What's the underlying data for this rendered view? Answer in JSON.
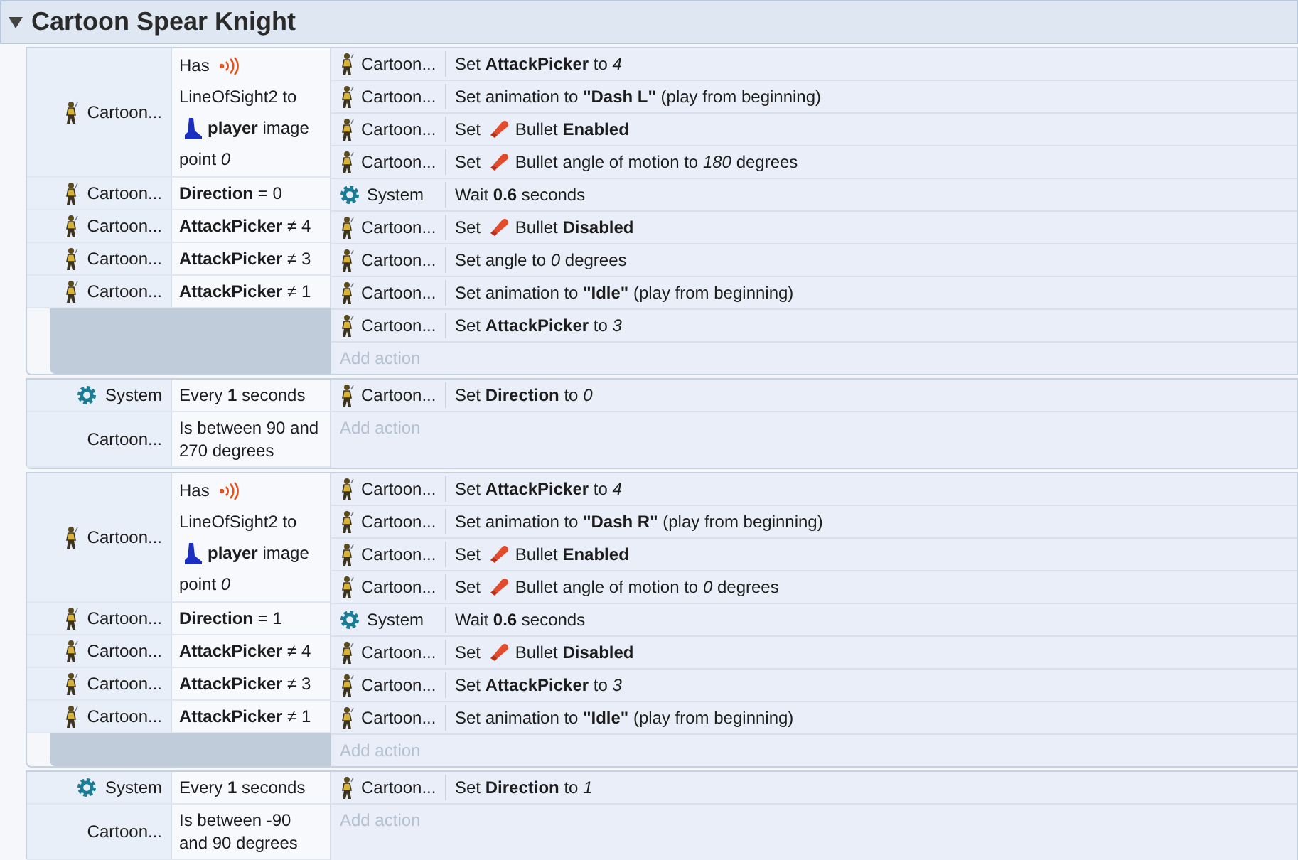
{
  "section": {
    "title": "Cartoon Spear Knight"
  },
  "events": [
    {
      "conditions": [
        {
          "kind": "sprite",
          "object": "Cartoon...",
          "parts": [
            {
              "kind": "text",
              "text": "Has"
            },
            {
              "kind": "signal"
            },
            {
              "kind": "text",
              "text": "LineOfSight2 to"
            },
            {
              "kind": "figure"
            },
            {
              "kind": "text",
              "text": "**player** image"
            },
            {
              "kind": "text",
              "text": "point *0*"
            }
          ]
        },
        {
          "kind": "sprite",
          "object": "Cartoon...",
          "parts": [
            {
              "kind": "text",
              "text": "**Direction** = 0"
            }
          ]
        },
        {
          "kind": "sprite",
          "object": "Cartoon...",
          "parts": [
            {
              "kind": "text",
              "text": "**AttackPicker** ≠ 4"
            }
          ]
        },
        {
          "kind": "sprite",
          "object": "Cartoon...",
          "parts": [
            {
              "kind": "text",
              "text": "**AttackPicker** ≠ 3"
            }
          ]
        },
        {
          "kind": "sprite",
          "object": "Cartoon...",
          "parts": [
            {
              "kind": "text",
              "text": "**AttackPicker** ≠ 1"
            }
          ]
        }
      ],
      "actions": [
        {
          "kind": "sprite",
          "object": "Cartoon...",
          "parts": [
            {
              "kind": "text",
              "text": "Set **AttackPicker** to *4*"
            }
          ]
        },
        {
          "kind": "sprite",
          "object": "Cartoon...",
          "parts": [
            {
              "kind": "text",
              "text": "Set animation to **\"Dash L\"** (play from beginning)"
            }
          ]
        },
        {
          "kind": "sprite",
          "object": "Cartoon...",
          "parts": [
            {
              "kind": "text",
              "text": "Set"
            },
            {
              "kind": "bullet"
            },
            {
              "kind": "text",
              "text": "Bullet **Enabled**"
            }
          ]
        },
        {
          "kind": "sprite",
          "object": "Cartoon...",
          "parts": [
            {
              "kind": "text",
              "text": "Set"
            },
            {
              "kind": "bullet"
            },
            {
              "kind": "text",
              "text": "Bullet angle of motion to *180* degrees"
            }
          ]
        },
        {
          "kind": "system",
          "object": "System",
          "parts": [
            {
              "kind": "text",
              "text": "Wait **0.6** seconds"
            }
          ]
        },
        {
          "kind": "sprite",
          "object": "Cartoon...",
          "parts": [
            {
              "kind": "text",
              "text": "Set"
            },
            {
              "kind": "bullet"
            },
            {
              "kind": "text",
              "text": "Bullet **Disabled**"
            }
          ]
        },
        {
          "kind": "sprite",
          "object": "Cartoon...",
          "parts": [
            {
              "kind": "text",
              "text": "Set angle to *0* degrees"
            }
          ]
        },
        {
          "kind": "sprite",
          "object": "Cartoon...",
          "parts": [
            {
              "kind": "text",
              "text": "Set animation to **\"Idle\"** (play from beginning)"
            }
          ]
        },
        {
          "kind": "sprite",
          "object": "Cartoon...",
          "parts": [
            {
              "kind": "text",
              "text": "Set **AttackPicker** to *3*"
            }
          ]
        }
      ],
      "add_action": "Add action"
    },
    {
      "conditions": [
        {
          "kind": "system",
          "object": "System",
          "parts": [
            {
              "kind": "text",
              "text": "Every **1** seconds"
            }
          ]
        },
        {
          "kind": "plain",
          "object": "Cartoon...",
          "parts": [
            {
              "kind": "text",
              "text": "Is between 90 and 270 degrees"
            }
          ]
        }
      ],
      "actions": [
        {
          "kind": "sprite",
          "object": "Cartoon...",
          "parts": [
            {
              "kind": "text",
              "text": "Set **Direction** to *0*"
            }
          ]
        }
      ],
      "add_action": "Add action"
    },
    {
      "conditions": [
        {
          "kind": "sprite",
          "object": "Cartoon...",
          "parts": [
            {
              "kind": "text",
              "text": "Has"
            },
            {
              "kind": "signal"
            },
            {
              "kind": "text",
              "text": "LineOfSight2 to"
            },
            {
              "kind": "figure"
            },
            {
              "kind": "text",
              "text": "**player** image"
            },
            {
              "kind": "text",
              "text": "point *0*"
            }
          ]
        },
        {
          "kind": "sprite",
          "object": "Cartoon...",
          "parts": [
            {
              "kind": "text",
              "text": "**Direction** = 1"
            }
          ]
        },
        {
          "kind": "sprite",
          "object": "Cartoon...",
          "parts": [
            {
              "kind": "text",
              "text": "**AttackPicker** ≠ 4"
            }
          ]
        },
        {
          "kind": "sprite",
          "object": "Cartoon...",
          "parts": [
            {
              "kind": "text",
              "text": "**AttackPicker** ≠ 3"
            }
          ]
        },
        {
          "kind": "sprite",
          "object": "Cartoon...",
          "parts": [
            {
              "kind": "text",
              "text": "**AttackPicker** ≠ 1"
            }
          ]
        }
      ],
      "actions": [
        {
          "kind": "sprite",
          "object": "Cartoon...",
          "parts": [
            {
              "kind": "text",
              "text": "Set **AttackPicker** to *4*"
            }
          ]
        },
        {
          "kind": "sprite",
          "object": "Cartoon...",
          "parts": [
            {
              "kind": "text",
              "text": "Set animation to **\"Dash R\"** (play from beginning)"
            }
          ]
        },
        {
          "kind": "sprite",
          "object": "Cartoon...",
          "parts": [
            {
              "kind": "text",
              "text": "Set"
            },
            {
              "kind": "bullet"
            },
            {
              "kind": "text",
              "text": "Bullet **Enabled**"
            }
          ]
        },
        {
          "kind": "sprite",
          "object": "Cartoon...",
          "parts": [
            {
              "kind": "text",
              "text": "Set"
            },
            {
              "kind": "bullet"
            },
            {
              "kind": "text",
              "text": "Bullet angle of motion to *0* degrees"
            }
          ]
        },
        {
          "kind": "system",
          "object": "System",
          "parts": [
            {
              "kind": "text",
              "text": "Wait **0.6** seconds"
            }
          ]
        },
        {
          "kind": "sprite",
          "object": "Cartoon...",
          "parts": [
            {
              "kind": "text",
              "text": "Set"
            },
            {
              "kind": "bullet"
            },
            {
              "kind": "text",
              "text": "Bullet **Disabled**"
            }
          ]
        },
        {
          "kind": "sprite",
          "object": "Cartoon...",
          "parts": [
            {
              "kind": "text",
              "text": "Set **AttackPicker** to *3*"
            }
          ]
        },
        {
          "kind": "sprite",
          "object": "Cartoon...",
          "parts": [
            {
              "kind": "text",
              "text": "Set animation to **\"Idle\"** (play from beginning)"
            }
          ]
        }
      ],
      "add_action": "Add action"
    },
    {
      "conditions": [
        {
          "kind": "system",
          "object": "System",
          "parts": [
            {
              "kind": "text",
              "text": "Every **1** seconds"
            }
          ]
        },
        {
          "kind": "plain",
          "object": "Cartoon...",
          "parts": [
            {
              "kind": "text",
              "text": "Is between -90 and 90 degrees"
            }
          ]
        }
      ],
      "actions": [
        {
          "kind": "sprite",
          "object": "Cartoon...",
          "parts": [
            {
              "kind": "text",
              "text": "Set **Direction** to *1*"
            }
          ]
        }
      ],
      "add_action": "Add action"
    }
  ]
}
